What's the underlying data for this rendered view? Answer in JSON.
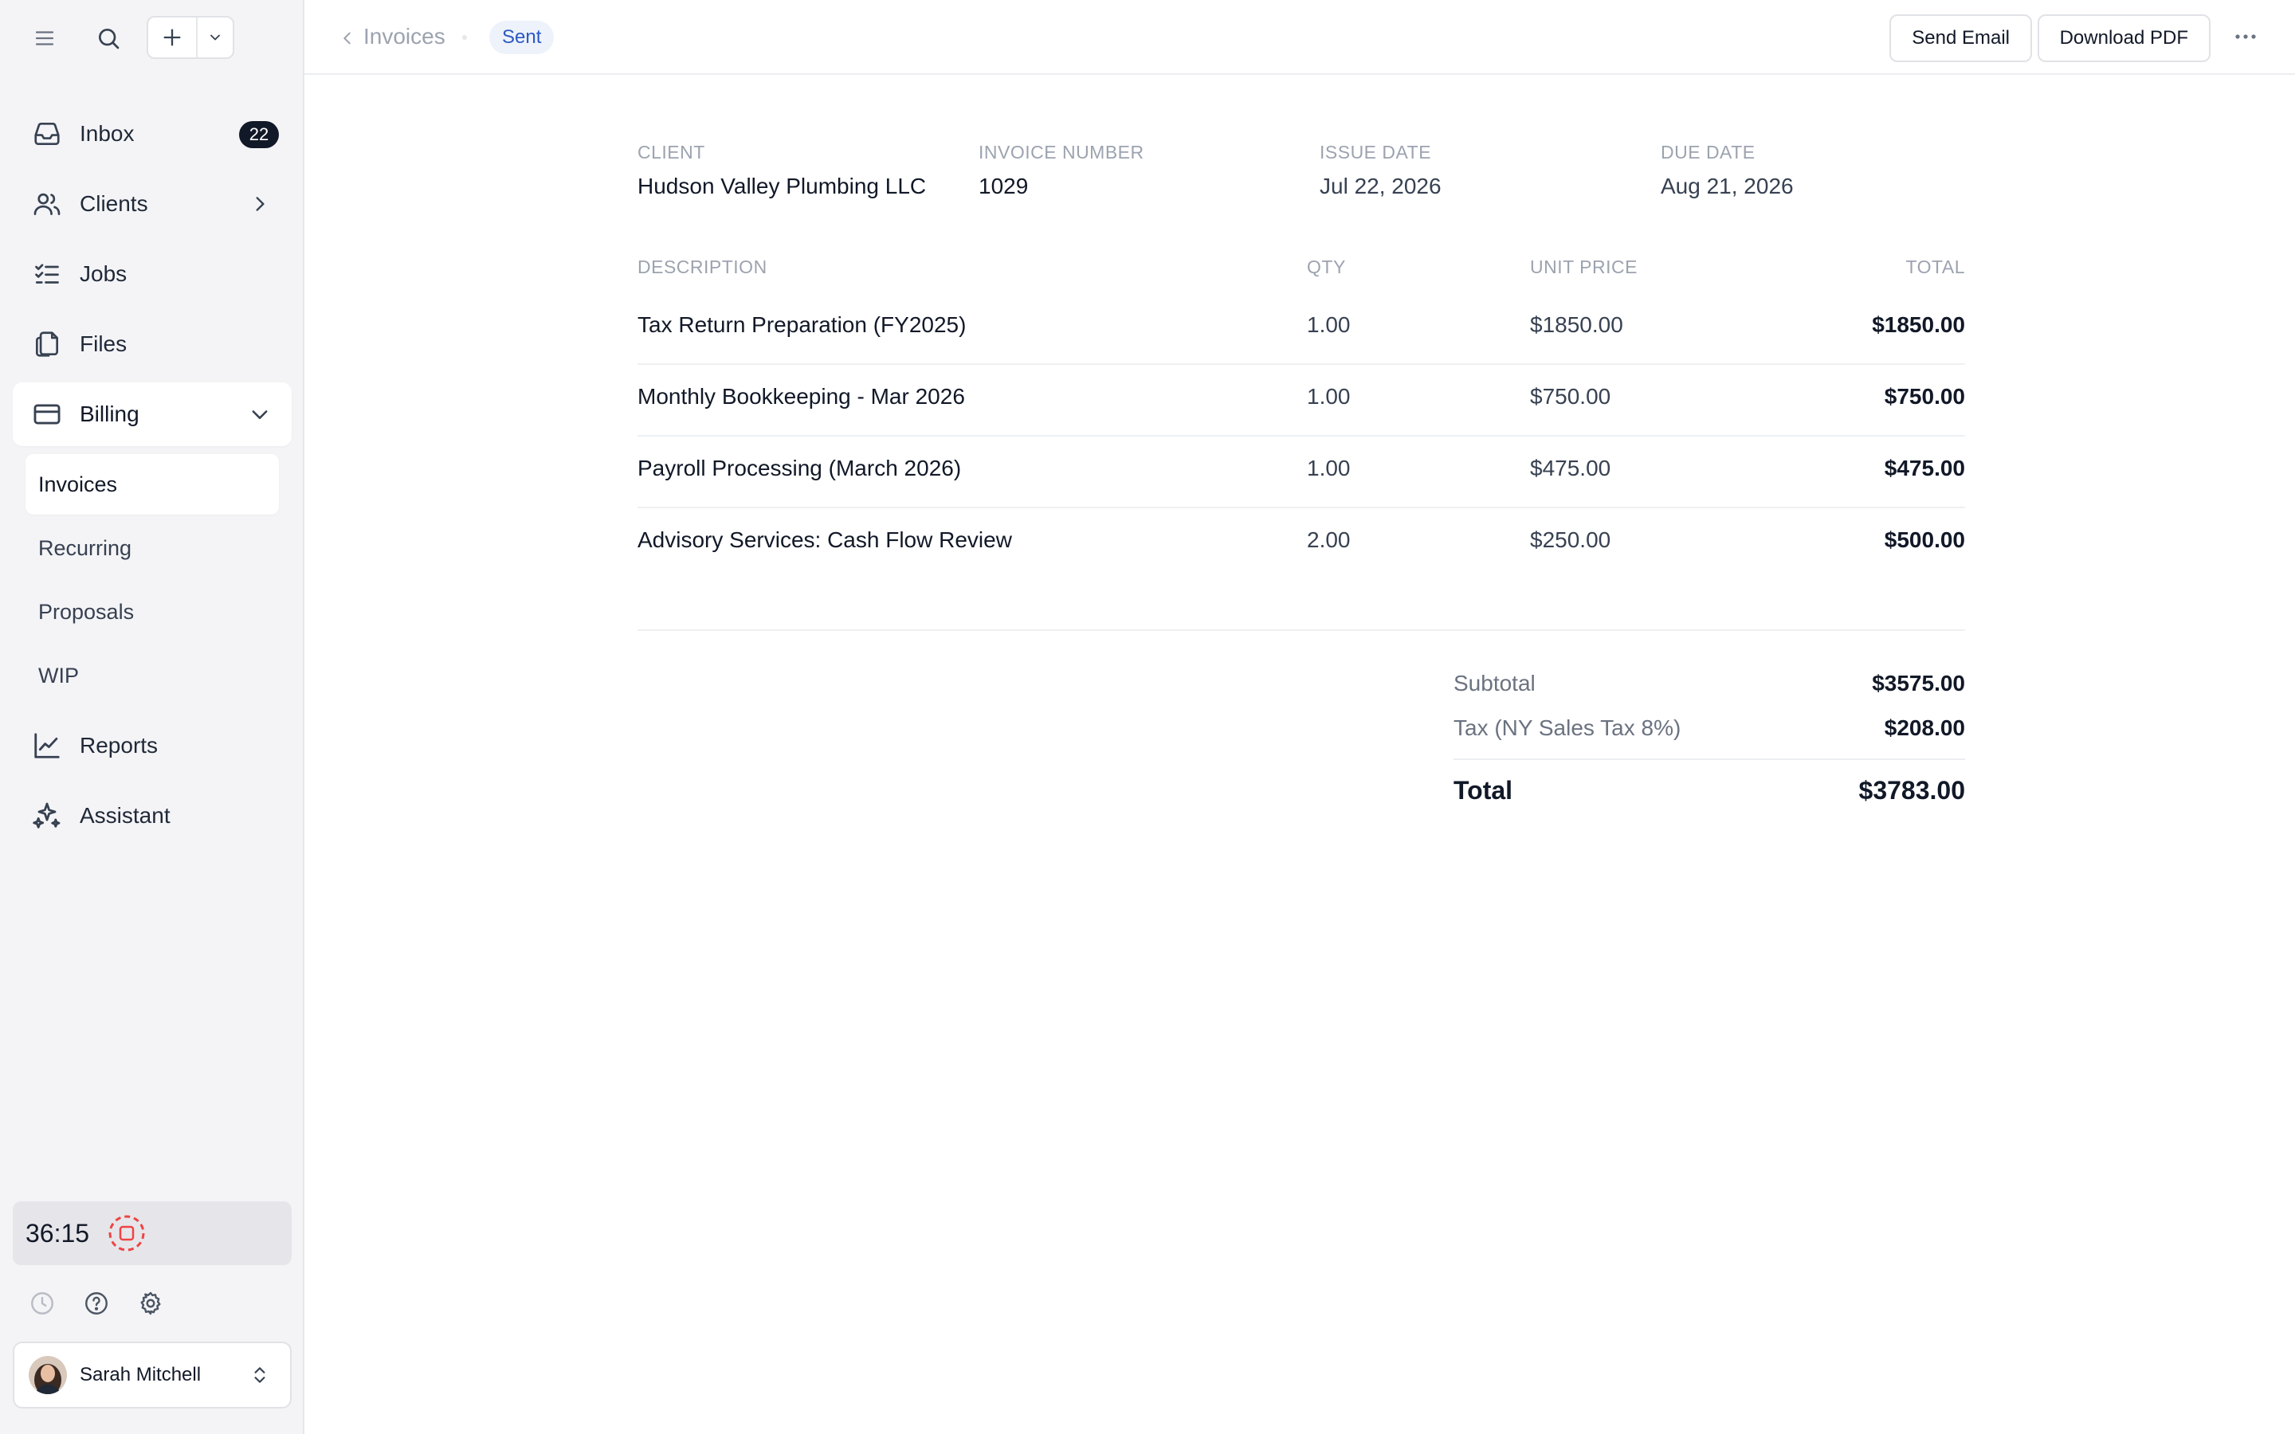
{
  "sidebar": {
    "nav": [
      {
        "label": "Inbox",
        "badge": "22"
      },
      {
        "label": "Clients"
      },
      {
        "label": "Jobs"
      },
      {
        "label": "Files"
      },
      {
        "label": "Billing"
      }
    ],
    "billing_sub": [
      "Invoices",
      "Recurring",
      "Proposals",
      "WIP"
    ],
    "nav_bottom": [
      {
        "label": "Reports"
      },
      {
        "label": "Assistant"
      }
    ],
    "timer": "36:15",
    "user": {
      "name": "Sarah Mitchell"
    }
  },
  "header": {
    "breadcrumb": "Invoices",
    "status": "Sent",
    "send_email": "Send Email",
    "download_pdf": "Download PDF"
  },
  "invoice": {
    "meta": [
      {
        "label": "CLIENT",
        "value": "Hudson Valley Plumbing LLC"
      },
      {
        "label": "INVOICE NUMBER",
        "value": "1029"
      },
      {
        "label": "ISSUE DATE",
        "value": "Jul 22, 2026"
      },
      {
        "label": "DUE DATE",
        "value": "Aug 21, 2026"
      }
    ],
    "columns": [
      "DESCRIPTION",
      "QTY",
      "UNIT PRICE",
      "TOTAL"
    ],
    "items": [
      {
        "description": "Tax Return Preparation (FY2025)",
        "qty": "1.00",
        "unit_price": "$1850.00",
        "total": "$1850.00"
      },
      {
        "description": "Monthly Bookkeeping - Mar 2026",
        "qty": "1.00",
        "unit_price": "$750.00",
        "total": "$750.00"
      },
      {
        "description": "Payroll Processing (March 2026)",
        "qty": "1.00",
        "unit_price": "$475.00",
        "total": "$475.00"
      },
      {
        "description": "Advisory Services: Cash Flow Review",
        "qty": "2.00",
        "unit_price": "$250.00",
        "total": "$500.00"
      }
    ],
    "subtotal_label": "Subtotal",
    "subtotal": "$3575.00",
    "tax_label": "Tax (NY Sales Tax 8%)",
    "tax": "$208.00",
    "total_label": "Total",
    "total": "$3783.00"
  },
  "colors": {
    "sidebar_bg": "#f4f4f7",
    "status_pill_bg": "#eef2fb",
    "status_pill_text": "#2b59c3",
    "badge_bg": "#111827",
    "recording_accent": "#ef4444"
  }
}
